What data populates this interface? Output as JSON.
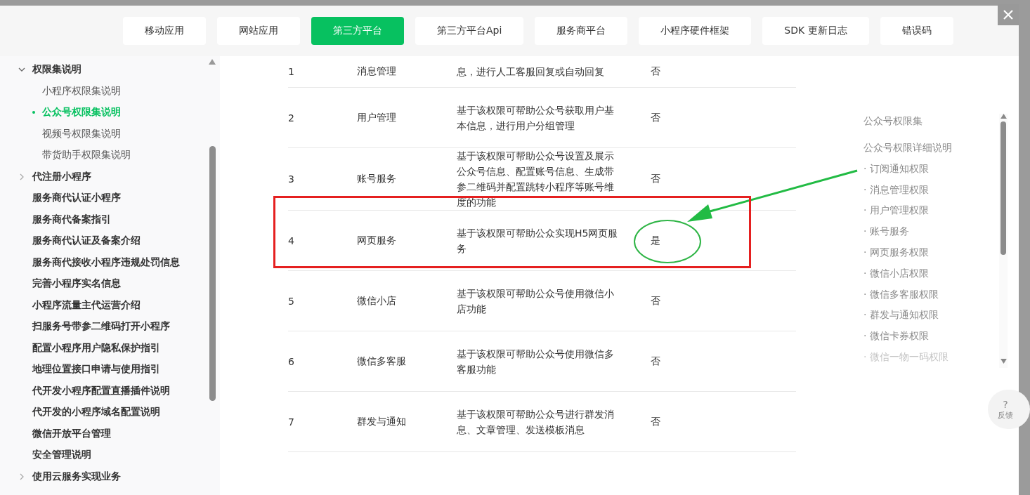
{
  "tabs": [
    {
      "label": "移动应用",
      "selected": false
    },
    {
      "label": "网站应用",
      "selected": false
    },
    {
      "label": "第三方平台",
      "selected": true
    },
    {
      "label": "第三方平台Api",
      "selected": false
    },
    {
      "label": "服务商平台",
      "selected": false
    },
    {
      "label": "小程序硬件框架",
      "selected": false
    },
    {
      "label": "SDK 更新日志",
      "selected": false
    },
    {
      "label": "错误码",
      "selected": false
    }
  ],
  "sidebar": {
    "items": [
      {
        "kind": "folder",
        "label": "权限集说明",
        "expanded": true,
        "children": [
          {
            "label": "小程序权限集说明",
            "selected": false
          },
          {
            "label": "公众号权限集说明",
            "selected": true
          },
          {
            "label": "视频号权限集说明",
            "selected": false
          },
          {
            "label": "带货助手权限集说明",
            "selected": false
          }
        ]
      },
      {
        "kind": "folder",
        "label": "代注册小程序",
        "expanded": false
      },
      {
        "kind": "page",
        "label": "服务商代认证小程序"
      },
      {
        "kind": "page",
        "label": "服务商代备案指引"
      },
      {
        "kind": "page",
        "label": "服务商代认证及备案介绍"
      },
      {
        "kind": "page",
        "label": "服务商代接收小程序违规处罚信息"
      },
      {
        "kind": "page",
        "label": "完善小程序实名信息"
      },
      {
        "kind": "page",
        "label": "小程序流量主代运营介绍"
      },
      {
        "kind": "page",
        "label": "扫服务号带参二维码打开小程序"
      },
      {
        "kind": "page",
        "label": "配置小程序用户隐私保护指引"
      },
      {
        "kind": "page",
        "label": "地理位置接口申请与使用指引"
      },
      {
        "kind": "page",
        "label": "代开发小程序配置直播插件说明"
      },
      {
        "kind": "page",
        "label": "代开发的小程序域名配置说明"
      },
      {
        "kind": "page",
        "label": "微信开放平台管理"
      },
      {
        "kind": "page",
        "label": "安全管理说明"
      },
      {
        "kind": "folder",
        "label": "使用云服务实现业务",
        "expanded": false
      }
    ]
  },
  "table": {
    "rows": [
      {
        "number": "1",
        "name": "消息管理",
        "description": "息，进行人工客服回复或自动回复",
        "answer": "否",
        "highlighted": false
      },
      {
        "number": "2",
        "name": "用户管理",
        "description": "基于该权限可帮助公众号获取用户基本信息，进行用户分组管理",
        "answer": "否",
        "highlighted": false
      },
      {
        "number": "3",
        "name": "账号服务",
        "description": "基于该权限可帮助公众号设置及展示公众号信息、配置账号信息、生成带参二维码并配置跳转小程序等账号维度的功能",
        "answer": "否",
        "highlighted": false
      },
      {
        "number": "4",
        "name": "网页服务",
        "description": "基于该权限可帮助公众实现H5网页服务",
        "answer": "是",
        "highlighted": true
      },
      {
        "number": "5",
        "name": "微信小店",
        "description": "基于该权限可帮助公众号使用微信小店功能",
        "answer": "否",
        "highlighted": false
      },
      {
        "number": "6",
        "name": "微信多客服",
        "description": "基于该权限可帮助公众号使用微信多客服功能",
        "answer": "否",
        "highlighted": false
      },
      {
        "number": "7",
        "name": "群发与通知",
        "description": "基于该权限可帮助公众号进行群发消息、文章管理、发送模板消息",
        "answer": "否",
        "highlighted": false
      }
    ]
  },
  "toc": {
    "items": [
      "公众号权限集",
      "公众号权限详细说明",
      "· 订阅通知权限",
      "· 消息管理权限",
      "· 用户管理权限",
      "· 账号服务",
      "· 网页服务权限",
      "· 微信小店权限",
      "· 微信多客服权限",
      "· 群发与通知权限",
      "· 微信卡券权限",
      "· 微信一物一码权限"
    ]
  },
  "feedback": {
    "icon": "?",
    "label": "反馈"
  }
}
